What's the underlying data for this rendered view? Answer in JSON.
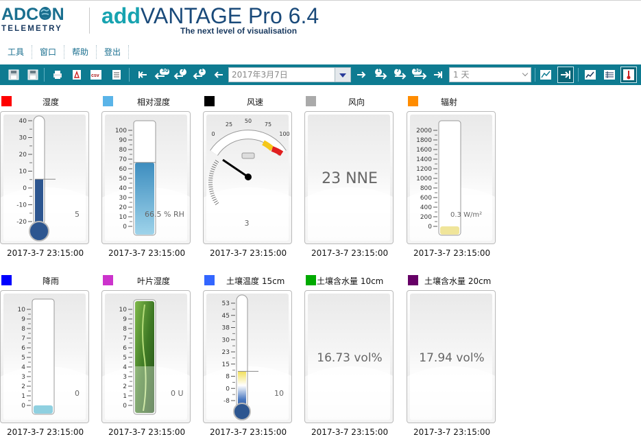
{
  "header": {
    "logo_top": "ADCON",
    "logo_bottom": "TELEMETRY",
    "app_title_prefix": "add",
    "app_title_rest": "VANTAGE Pro 6.4",
    "subtitle": "The next level of visualisation"
  },
  "menu": {
    "items": [
      "工具",
      "窗口",
      "帮助",
      "登出"
    ]
  },
  "toolbar": {
    "date_value": "2017年3月7日",
    "range_value": "1 天",
    "step_labels": [
      "30",
      "7",
      "1",
      "1",
      "7",
      "30"
    ],
    "accent": "#0e7b91"
  },
  "sensors": [
    {
      "label": "湿度",
      "color": "#ff0000",
      "type": "thermometer",
      "ticks": [
        "40",
        "30",
        "20",
        "10",
        "0",
        "-10",
        "-20"
      ],
      "value_text": "5",
      "level": 0.42,
      "timestamp": "2017-3-7 23:15:00"
    },
    {
      "label": "相对湿度",
      "color": "#5ab4e8",
      "type": "tube",
      "ticks": [
        "100",
        "90",
        "80",
        "70",
        "60",
        "50",
        "40",
        "30",
        "20",
        "10",
        "0"
      ],
      "value_text": "66.5 % RH",
      "level": 0.665,
      "timestamp": "2017-3-7 23:15:00"
    },
    {
      "label": "风速",
      "color": "#000000",
      "type": "gauge",
      "ticks": [
        "0",
        "25",
        "50",
        "75",
        "100"
      ],
      "value_text": "3",
      "level": 0.03,
      "timestamp": "2017-3-7 23:15:00"
    },
    {
      "label": "风向",
      "color": "#aaaaaa",
      "type": "text",
      "value_text": "23  NNE",
      "timestamp": "2017-3-7 23:15:00"
    },
    {
      "label": "辐射",
      "color": "#ff8c00",
      "type": "tube",
      "ticks": [
        "2000",
        "1800",
        "1600",
        "1400",
        "1200",
        "1000",
        "800",
        "600",
        "400",
        "200",
        "0"
      ],
      "value_text": "0.3 W/m²",
      "level": 0.0,
      "timestamp": "2017-3-7 23:15:00"
    },
    {
      "label": "降雨",
      "color": "#0000ff",
      "type": "tube",
      "ticks": [
        "10",
        "9",
        "8",
        "7",
        "6",
        "5",
        "4",
        "3",
        "2",
        "1",
        "0"
      ],
      "value_text": "0",
      "level": 0.0,
      "timestamp": "2017-3-7 23:15:00"
    },
    {
      "label": "叶片湿度",
      "color": "#cc33cc",
      "type": "leaf",
      "ticks": [
        "10",
        "9",
        "8",
        "7",
        "6",
        "5",
        "4",
        "3",
        "2",
        "1",
        "0"
      ],
      "value_text": "0 U",
      "level": 0.0,
      "timestamp": "2017-3-7 23:15:00"
    },
    {
      "label": "土壤温度 15cm",
      "color": "#3366ff",
      "type": "thermometer2",
      "ticks": [
        "53",
        "45",
        "38",
        "30",
        "23",
        "15",
        "8",
        "0",
        "-8"
      ],
      "value_text": "10",
      "level": 0.3,
      "timestamp": "2017-3-7 23:15:00"
    },
    {
      "label": "土壤含水量 10cm",
      "color": "#00aa00",
      "type": "text",
      "value_text": "16.73 vol%",
      "timestamp": "2017-3-7 23:15:00"
    },
    {
      "label": "土壤含水量 20cm",
      "color": "#660066",
      "type": "text",
      "value_text": "17.94 vol%",
      "timestamp": "2017-3-7 23:15:00"
    }
  ]
}
